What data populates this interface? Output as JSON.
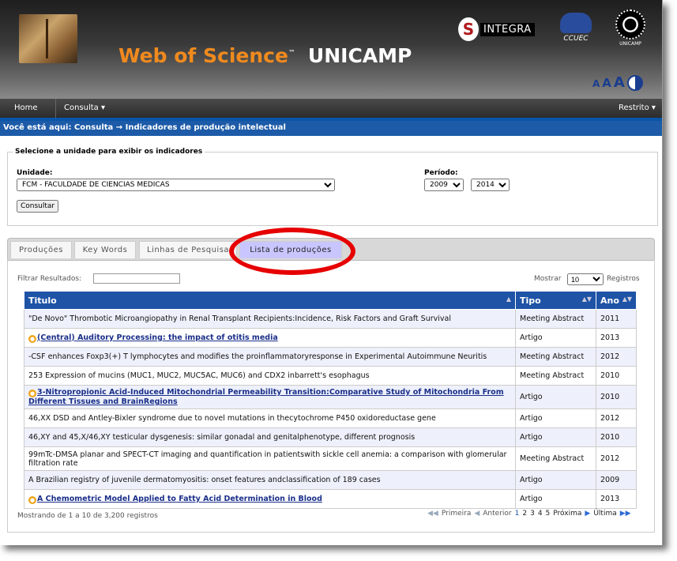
{
  "header": {
    "brand_wos": "Web of Science",
    "brand_tm": "™",
    "brand_unicamp": "UNICAMP",
    "logo_integra": "INTEGRA",
    "logo_integra_s": "S",
    "logo_ccuec": "CCUEC",
    "logo_unicamp": "UNICAMP",
    "font_small": "A",
    "font_medium": "A",
    "font_large": "A"
  },
  "nav": {
    "home": "Home",
    "consulta": "Consulta ▾",
    "restrito": "Restrito ▾"
  },
  "breadcrumb": "Você está aqui:  Consulta → Indicadores de produção intelectual",
  "form": {
    "title": "Selecione a unidade para exibir os indicadores",
    "unidade_label": "Unidade:",
    "unidade_value": "FCM - FACULDADE DE CIENCIAS MEDICAS",
    "periodo_label": "Período:",
    "year_from": "2009",
    "year_to": "2014",
    "consultar": "Consultar"
  },
  "tabs": [
    "Produções",
    "Key Words",
    "Linhas de Pesquisa",
    "Lista de produções"
  ],
  "list": {
    "filter_label": "Filtrar Resultados:",
    "mostrar": "Mostrar",
    "page_size": "10",
    "registros": "Registros",
    "columns": [
      "Titulo",
      "Tipo",
      "Ano"
    ],
    "rows": [
      {
        "title": "\"De Novo\" Thrombotic Microangiopathy in Renal Transplant Recipients:Incidence, Risk Factors and Graft Survival",
        "tipo": "Meeting Abstract",
        "ano": "2011",
        "oa": false
      },
      {
        "title": "(Central) Auditory Processing: the impact of otitis media",
        "tipo": "Artigo",
        "ano": "2013",
        "oa": true
      },
      {
        "title": "-CSF enhances Foxp3(+) T lymphocytes and modifies the proinflammatoryresponse in Experimental Autoimmune Neuritis",
        "tipo": "Meeting Abstract",
        "ano": "2012",
        "oa": false
      },
      {
        "title": "253 Expression of mucins (MUC1, MUC2, MUC5AC, MUC6) and CDX2 inbarrett's esophagus",
        "tipo": "Meeting Abstract",
        "ano": "2010",
        "oa": false
      },
      {
        "title": "3-Nitropropionic Acid-Induced Mitochondrial Permeability Transition:Comparative Study of Mitochondria From Different Tissues and BrainRegions",
        "tipo": "Artigo",
        "ano": "2010",
        "oa": true
      },
      {
        "title": "46,XX DSD and Antley-Bixler syndrome due to novel mutations in thecytochrome P450 oxidoreductase gene",
        "tipo": "Artigo",
        "ano": "2012",
        "oa": false
      },
      {
        "title": "46,XY and 45,X/46,XY testicular dysgenesis: similar gonadal and genitalphenotype, different prognosis",
        "tipo": "Artigo",
        "ano": "2010",
        "oa": false
      },
      {
        "title": "99mTc-DMSA planar and SPECT-CT imaging and quantification in patientswith sickle cell anemia: a comparison with glomerular filtration rate",
        "tipo": "Meeting Abstract",
        "ano": "2012",
        "oa": false
      },
      {
        "title": "A Brazilian registry of juvenile dermatomyositis: onset features andclassification of 189 cases",
        "tipo": "Artigo",
        "ano": "2009",
        "oa": false
      },
      {
        "title": "A Chemometric Model Applied to Fatty Acid Determination in Blood",
        "tipo": "Artigo",
        "ano": "2013",
        "oa": true
      }
    ],
    "info": "Mostrando de 1 a 10 de 3,200 registros",
    "pager": {
      "primeira": "Primeira",
      "anterior": "Anterior",
      "pages": [
        "1",
        "2",
        "3",
        "4",
        "5"
      ],
      "proxima": "Próxima",
      "ultima": "Última"
    }
  },
  "colors": {
    "header_blue": "#1e53a6",
    "brand_orange": "#f08a1e",
    "highlight_red": "#e60000",
    "active_tab": "#c9c6ff"
  }
}
